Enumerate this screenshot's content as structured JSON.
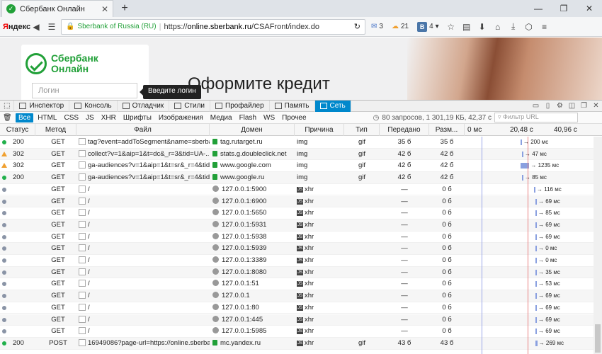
{
  "browser": {
    "tab_title": "Сбербанк Онлайн",
    "tab_favicon": "sberbank-favicon",
    "new_tab": "+",
    "yandex_logo_red": "Я",
    "yandex_logo_rest": "ндекс",
    "site_identity": "Sberbank of Russia (RU)",
    "url_prefix": "https://",
    "url_domain": "online.sberbank.ru",
    "url_path": "/CSAFront/index.do",
    "mail_count": "3",
    "weather_temp": "21",
    "vk_label": "В",
    "vk_count": "4"
  },
  "page": {
    "logo_line1": "Сбербанк",
    "logo_line2": "Онлайн",
    "login_placeholder": "Логин",
    "tooltip": "Введите логин",
    "promo_title": "Оформите кредит"
  },
  "devtools": {
    "tabs": [
      "Инспектор",
      "Консоль",
      "Отладчик",
      "Стили",
      "Профайлер",
      "Память",
      "Сеть"
    ],
    "active_tab": "Сеть",
    "filters": [
      "Все",
      "HTML",
      "CSS",
      "JS",
      "XHR",
      "Шрифты",
      "Изображения",
      "Медиа",
      "Flash",
      "WS",
      "Прочее"
    ],
    "active_filter": "Все",
    "summary": "80 запросов, 1 301,19 КБ, 42,37 с",
    "filter_placeholder": "Фильтр URL",
    "columns": [
      "Статус",
      "Метод",
      "Файл",
      "Домен",
      "Причина",
      "Тип",
      "Передано",
      "Разм...",
      "0 мс",
      "20,48 с",
      "40,96 с"
    ],
    "rows": [
      {
        "status_icon": "green",
        "status": "200",
        "method": "GET",
        "file": "tag?event=addToSegment&name=sberba...",
        "domain": "tag.rutarget.ru",
        "secure": true,
        "cause": "img",
        "cause_js": false,
        "type": "gif",
        "transferred": "35 б",
        "size": "35 б",
        "timing": "→ 200 мс"
      },
      {
        "status_icon": "warning",
        "status": "302",
        "method": "GET",
        "file": "collect?v=1&aip=1&t=dc&_r=3&tid=UA-...",
        "domain": "stats.g.doubleclick.net",
        "secure": true,
        "cause": "img",
        "cause_js": false,
        "type": "gif",
        "transferred": "42 б",
        "size": "42 б",
        "timing": "→ 47 мс"
      },
      {
        "status_icon": "warning",
        "status": "302",
        "method": "GET",
        "file": "ga-audiences?v=1&aip=1&t=sr&_r=4&tid...",
        "domain": "www.google.com",
        "secure": true,
        "cause": "img",
        "cause_js": false,
        "type": "gif",
        "transferred": "42 б",
        "size": "42 б",
        "timing": "→ 1235 мс"
      },
      {
        "status_icon": "green",
        "status": "200",
        "method": "GET",
        "file": "ga-audiences?v=1&aip=1&t=sr&_r=4&tid...",
        "domain": "www.google.ru",
        "secure": true,
        "cause": "img",
        "cause_js": false,
        "type": "gif",
        "transferred": "42 б",
        "size": "42 б",
        "timing": "→ 85 мс"
      },
      {
        "status_icon": "gray",
        "status": "",
        "method": "GET",
        "file": "/",
        "domain": "127.0.0.1:5900",
        "secure": false,
        "cause": "xhr",
        "cause_js": true,
        "type": "",
        "transferred": "—",
        "size": "0 б",
        "timing": "→ 116 мс"
      },
      {
        "status_icon": "gray",
        "status": "",
        "method": "GET",
        "file": "/",
        "domain": "127.0.0.1:6900",
        "secure": false,
        "cause": "xhr",
        "cause_js": true,
        "type": "",
        "transferred": "—",
        "size": "0 б",
        "timing": "→ 69 мс"
      },
      {
        "status_icon": "gray",
        "status": "",
        "method": "GET",
        "file": "/",
        "domain": "127.0.0.1:5650",
        "secure": false,
        "cause": "xhr",
        "cause_js": true,
        "type": "",
        "transferred": "—",
        "size": "0 б",
        "timing": "→ 85 мс"
      },
      {
        "status_icon": "gray",
        "status": "",
        "method": "GET",
        "file": "/",
        "domain": "127.0.0.1:5931",
        "secure": false,
        "cause": "xhr",
        "cause_js": true,
        "type": "",
        "transferred": "—",
        "size": "0 б",
        "timing": "→ 69 мс"
      },
      {
        "status_icon": "gray",
        "status": "",
        "method": "GET",
        "file": "/",
        "domain": "127.0.0.1:5938",
        "secure": false,
        "cause": "xhr",
        "cause_js": true,
        "type": "",
        "transferred": "—",
        "size": "0 б",
        "timing": "→ 69 мс"
      },
      {
        "status_icon": "gray",
        "status": "",
        "method": "GET",
        "file": "/",
        "domain": "127.0.0.1:5939",
        "secure": false,
        "cause": "xhr",
        "cause_js": true,
        "type": "",
        "transferred": "—",
        "size": "0 б",
        "timing": "→ 0 мс"
      },
      {
        "status_icon": "gray",
        "status": "",
        "method": "GET",
        "file": "/",
        "domain": "127.0.0.1:3389",
        "secure": false,
        "cause": "xhr",
        "cause_js": true,
        "type": "",
        "transferred": "—",
        "size": "0 б",
        "timing": "→ 0 мс"
      },
      {
        "status_icon": "gray",
        "status": "",
        "method": "GET",
        "file": "/",
        "domain": "127.0.0.1:8080",
        "secure": false,
        "cause": "xhr",
        "cause_js": true,
        "type": "",
        "transferred": "—",
        "size": "0 б",
        "timing": "→ 35 мс"
      },
      {
        "status_icon": "gray",
        "status": "",
        "method": "GET",
        "file": "/",
        "domain": "127.0.0.1:51",
        "secure": false,
        "cause": "xhr",
        "cause_js": true,
        "type": "",
        "transferred": "—",
        "size": "0 б",
        "timing": "→ 53 мс"
      },
      {
        "status_icon": "gray",
        "status": "",
        "method": "GET",
        "file": "/",
        "domain": "127.0.0.1",
        "secure": false,
        "cause": "xhr",
        "cause_js": true,
        "type": "",
        "transferred": "—",
        "size": "0 б",
        "timing": "→ 69 мс"
      },
      {
        "status_icon": "gray",
        "status": "",
        "method": "GET",
        "file": "/",
        "domain": "127.0.0.1:80",
        "secure": false,
        "cause": "xhr",
        "cause_js": true,
        "type": "",
        "transferred": "—",
        "size": "0 б",
        "timing": "→ 69 мс"
      },
      {
        "status_icon": "gray",
        "status": "",
        "method": "GET",
        "file": "/",
        "domain": "127.0.0.1:445",
        "secure": false,
        "cause": "xhr",
        "cause_js": true,
        "type": "",
        "transferred": "—",
        "size": "0 б",
        "timing": "→ 69 мс"
      },
      {
        "status_icon": "gray",
        "status": "",
        "method": "GET",
        "file": "/",
        "domain": "127.0.0.1:5985",
        "secure": false,
        "cause": "xhr",
        "cause_js": true,
        "type": "",
        "transferred": "—",
        "size": "0 б",
        "timing": "→ 69 мс"
      },
      {
        "status_icon": "green",
        "status": "200",
        "method": "POST",
        "file": "16949086?page-url=https://online.sberbank...",
        "domain": "mc.yandex.ru",
        "secure": true,
        "cause": "xhr",
        "cause_js": true,
        "type": "gif",
        "transferred": "43 б",
        "size": "43 б",
        "timing": "→ 269 мс"
      }
    ]
  },
  "colors": {
    "accent": "#0088cc",
    "brand": "#21a038",
    "ok": "#21b04b",
    "warning": "#f0a030",
    "pending": "#8a94a6"
  }
}
